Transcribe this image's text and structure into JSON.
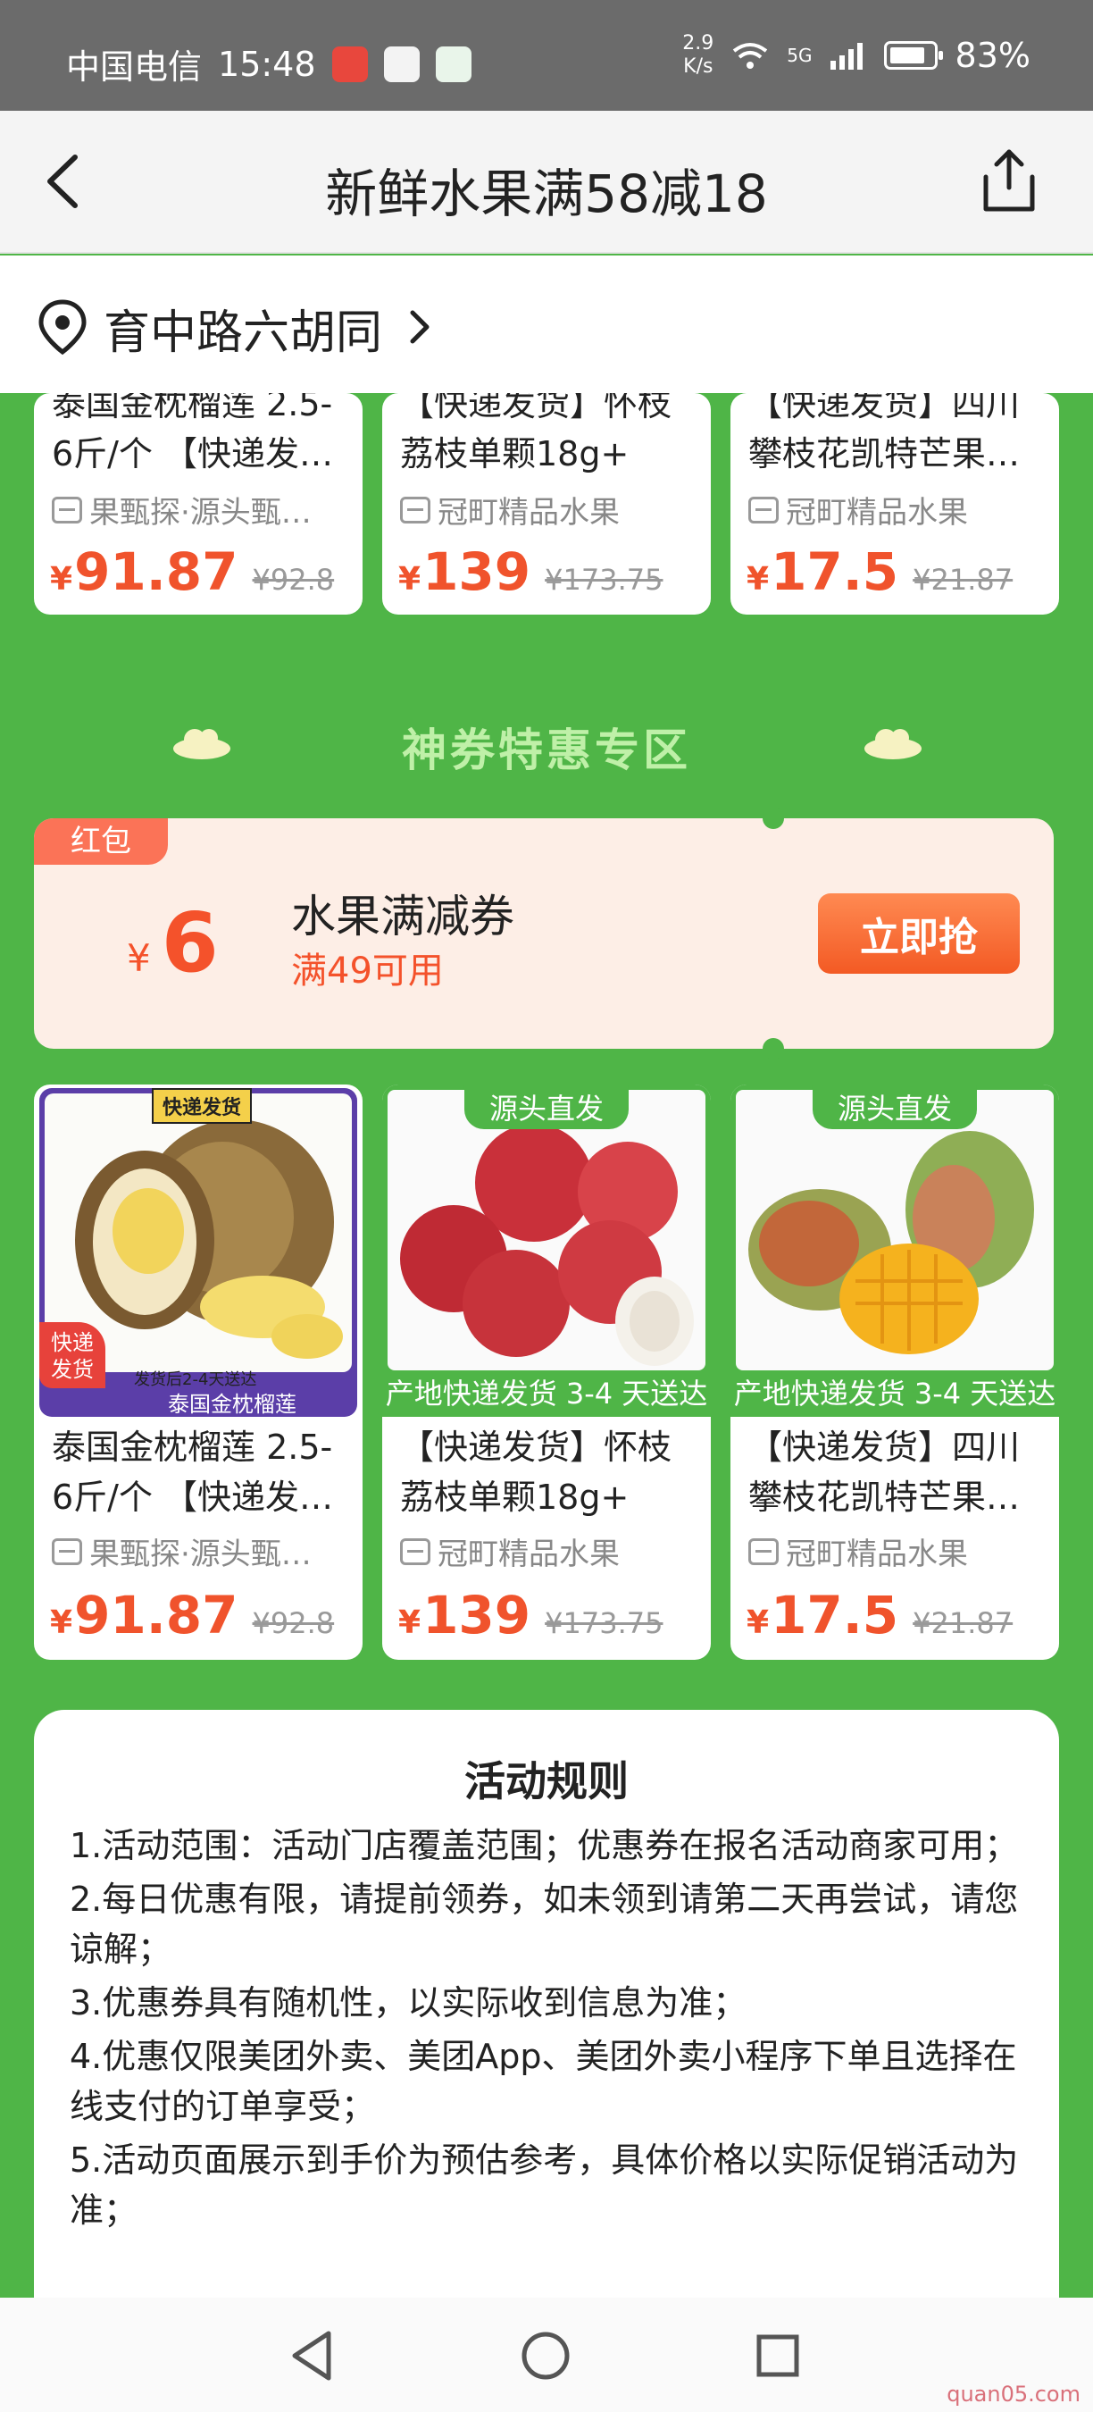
{
  "status_bar": {
    "carrier": "中国电信",
    "time": "15:48",
    "net_speed_value": "2.9",
    "net_speed_unit": "K/s",
    "network": "5G",
    "battery": "83%"
  },
  "nav": {
    "title": "新鲜水果满58减18"
  },
  "address": {
    "text": "育中路六胡同"
  },
  "top_products": [
    {
      "title": "泰国金枕榴莲 2.5-6斤/个 【快递发…",
      "shop": "果甄探·源头甄…",
      "price": "91.87",
      "old_price": "¥92.8"
    },
    {
      "title": "【快递发货】怀枝荔枝单颗18g+",
      "shop": "冠町精品水果",
      "price": "139",
      "old_price": "¥173.75"
    },
    {
      "title": "【快递发货】四川攀枝花凯特芒果…",
      "shop": "冠町精品水果",
      "price": "17.5",
      "old_price": "¥21.87"
    }
  ],
  "section": {
    "title": "神券特惠专区"
  },
  "coupon": {
    "tag": "红包",
    "currency": "¥",
    "amount": "6",
    "name": "水果满减券",
    "condition": "满49可用",
    "button": "立即抢"
  },
  "products": [
    {
      "badge_top": "快递发货",
      "badge_corner": "快递\n发货",
      "image_caption_small": "发货后2-4天送达",
      "image_caption": "泰国金枕榴莲",
      "title": "泰国金枕榴莲 2.5-6斤/个 【快递发…",
      "shop": "果甄探·源头甄…",
      "price": "91.87",
      "old_price": "¥92.8"
    },
    {
      "badge_top": "源头直发",
      "strip": "产地快递发货 3-4 天送达",
      "title": "【快递发货】怀枝荔枝单颗18g+",
      "shop": "冠町精品水果",
      "price": "139",
      "old_price": "¥173.75"
    },
    {
      "badge_top": "源头直发",
      "strip": "产地快递发货 3-4 天送达",
      "title": "【快递发货】四川攀枝花凯特芒果…",
      "shop": "冠町精品水果",
      "price": "17.5",
      "old_price": "¥21.87"
    }
  ],
  "rules": {
    "title": "活动规则",
    "items": [
      "1.活动范围：活动门店覆盖范围；优惠券在报名活动商家可用；",
      "2.每日优惠有限，请提前领券，如未领到请第二天再尝试，请您谅解；",
      "3.优惠券具有随机性，以实际收到信息为准；",
      "4.优惠仅限美团外卖、美团App、美团外卖小程序下单且选择在线支付的订单享受；",
      "5.活动页面展示到手价为预估参考，具体价格以实际促销活动为准；"
    ]
  },
  "watermark": "quan05.com",
  "colors": {
    "page_bg": "#4fb547",
    "price": "#f0532c",
    "coupon_bg": "#fdeee6",
    "coupon_button": "#f35a24"
  }
}
